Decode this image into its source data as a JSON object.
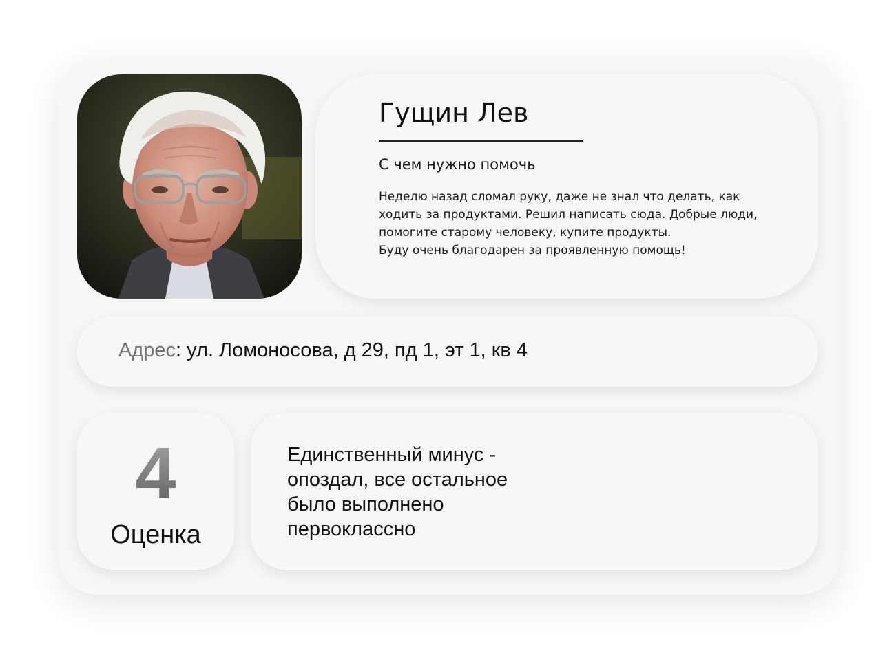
{
  "profile": {
    "name": "Гущин Лев",
    "photo_alt": "avatar-photo"
  },
  "request": {
    "title": "С чем нужно помочь",
    "lines": [
      "Неделю назад сломал руку, даже не знал что делать, как",
      "ходить за продуктами. Решил написать сюда. Добрые люди,",
      "помогите старому человеку, купите продукты.",
      "Буду очень благодарен за проявленную помощь!"
    ]
  },
  "address": {
    "label": "Адрес",
    "value": "ул. Ломоносова, д 29, пд 1, эт 1, кв 4"
  },
  "rating": {
    "value": "4",
    "label": "Оценка"
  },
  "review": {
    "lines": [
      "Единственный минус -",
      "опоздал, все остальное",
      "было выполнено",
      "первоклассно"
    ]
  }
}
